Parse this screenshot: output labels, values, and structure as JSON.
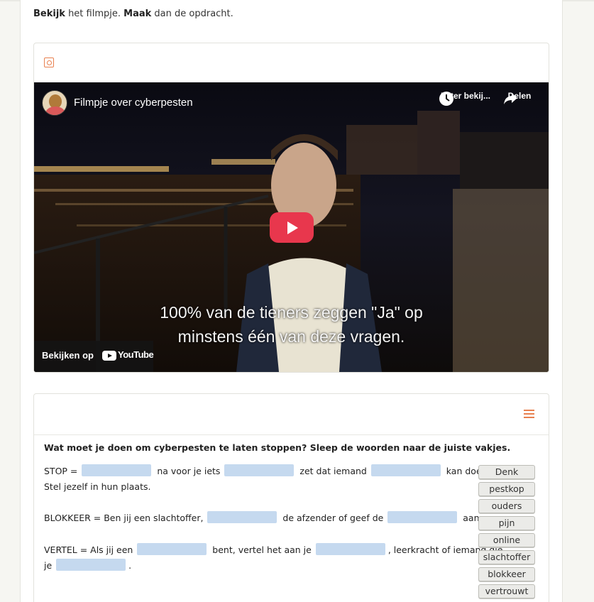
{
  "intro": {
    "bold1": "Bekijk",
    "text1": " het filmpje. ",
    "bold2": "Maak",
    "text2": " dan de opdracht."
  },
  "video": {
    "title": "Filmpje over cyberpesten",
    "watch_later": "Later bekij...",
    "share": "Delen",
    "subtitle_line1": "100% van de tieners zeggen \"Ja\" op",
    "subtitle_line2": "minstens één van deze vragen.",
    "watch_on": "Bekijken op",
    "youtube": "YouTube"
  },
  "quiz": {
    "question": "Wat moet je doen om cyberpesten te laten stoppen? Sleep de woorden naar de juiste vakjes.",
    "stop": {
      "prefix": "STOP = ",
      "part1": " na voor je iets ",
      "part2": " zet dat iemand ",
      "part3": " kan doen.",
      "line2": "Stel jezelf in hun plaats."
    },
    "blokkeer": {
      "prefix": "BLOKKEER = Ben jij een slachtoffer, ",
      "part1": " de afzender of geef de ",
      "part2": " aan."
    },
    "vertel": {
      "prefix": "VERTEL = Als jij een ",
      "part1": " bent, vertel het aan je ",
      "part2": ", leerkracht of iemand die",
      "line2_prefix": "je ",
      "line2_suffix": "."
    },
    "words": [
      "Denk",
      "pestkop",
      "ouders",
      "pijn",
      "online",
      "slachtoffer",
      "blokkeer",
      "vertrouwt"
    ]
  },
  "colors": {
    "accent": "#e8804f",
    "blank": "#c5d9ef",
    "play": "#e8374d"
  }
}
